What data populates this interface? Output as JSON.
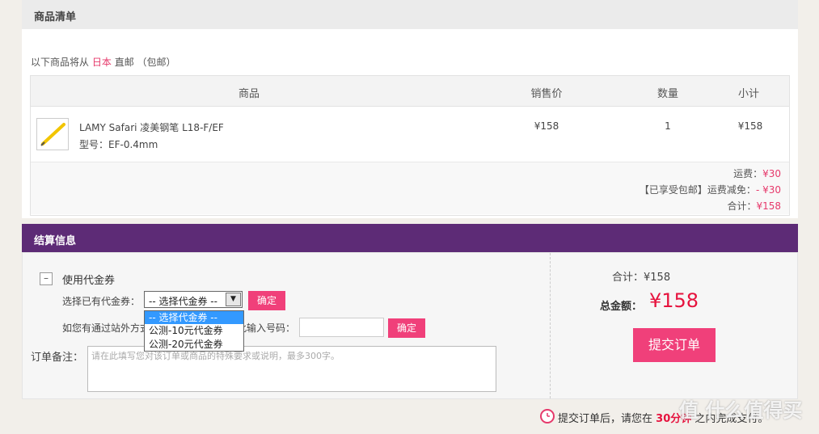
{
  "goods_section": {
    "title": "商品清单",
    "ship_prefix": "以下商品将从",
    "ship_country": "日本",
    "ship_suffix": "直邮",
    "ship_note": "（包邮）",
    "columns": [
      "商品",
      "销售价",
      "数量",
      "小计"
    ],
    "item": {
      "name": "LAMY Safari 凌美钢笔 L18-F/EF",
      "model": "型号：EF-0.4mm",
      "price": "¥158",
      "qty": "1",
      "subtotal": "¥158"
    },
    "summary": {
      "freight_label": "运费：",
      "freight_value": "¥30",
      "discount_label": "【已享受包邮】运费减免：",
      "discount_value": "- ¥30",
      "total_label": "合计：",
      "total_value": "¥158"
    }
  },
  "checkout_section": {
    "title": "结算信息",
    "coupon_toggle": "–",
    "coupon_label": "使用代金券",
    "select_label": "选择已有代金券：",
    "select_value": "-- 选择代金券 --",
    "select_options": [
      "-- 选择代金券 --",
      "公测-10元代金券",
      "公测-20元代金券"
    ],
    "confirm_label": "确定",
    "other_label": "如您有通过站外方式获得的代金券，请在此输入号码：",
    "confirm2_label": "确定",
    "note_label": "订单备注：",
    "note_placeholder": "请在此填写您对该订单或商品的特殊要求或说明，最多300字。",
    "subtotal_label": "合计：",
    "subtotal_value": "¥158",
    "total_label": "总金额：",
    "total_value": "¥158",
    "submit_label": "提交订单"
  },
  "footer": {
    "notice_prefix": "提交订单后，请您在",
    "notice_time": "30分钟",
    "notice_suffix": "之内完成支付。",
    "watermark": "值 什么值得买"
  },
  "colors": {
    "accent_pink": "#f0407a",
    "header_purple": "#5d2b76",
    "price_red": "#e6133e"
  }
}
